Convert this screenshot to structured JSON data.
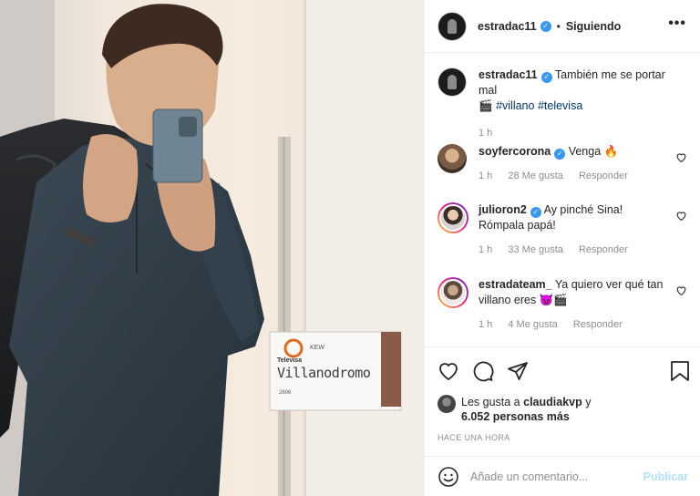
{
  "post": {
    "author": "estradac11",
    "follow_state": "Siguiendo",
    "more_icon": "more-horizontal-icon",
    "caption_author": "estradac11",
    "caption_text": "También me se portar mal",
    "caption_emoji": "🎬",
    "hashtags": [
      "#villano",
      "#televisa"
    ],
    "caption_time": "1 h"
  },
  "photo": {
    "board_brand": "Televisa",
    "board_sub": "KEW",
    "board_title": "Villanodromo",
    "board_number": "2606"
  },
  "comments": [
    {
      "user": "soyfercorona",
      "verified": true,
      "text": "Venga 🔥",
      "time": "1 h",
      "likes": "28 Me gusta",
      "reply": "Responder"
    },
    {
      "user": "julioron2",
      "verified": true,
      "text": "Ay pinché Sina! Rómpala papá!",
      "text_line1": "Ay pinché Sina!",
      "text_line2": "Rómpala papá!",
      "time": "1 h",
      "likes": "33 Me gusta",
      "reply": "Responder"
    },
    {
      "user": "estradateam_",
      "verified": false,
      "text": "Ya quiero ver qué tan villano eres 👿🎬",
      "text_line1": "Ya quiero ver qué tan",
      "text_line2": "villano eres 👿🎬",
      "time": "1 h",
      "likes": "4 Me gusta",
      "reply": "Responder"
    }
  ],
  "likes": {
    "prefix": "Les gusta a",
    "user": "claudiakvp",
    "suffix": "y",
    "count_text": "6.052 personas más"
  },
  "timestamp": "HACE UNA HORA",
  "add_comment": {
    "placeholder": "Añade un comentario...",
    "publish_label": "Publicar"
  },
  "colors": {
    "verified": "#3897f0",
    "link": "#00376b",
    "publish_disabled": "#b2dffc",
    "muted": "#8e8e8e"
  }
}
